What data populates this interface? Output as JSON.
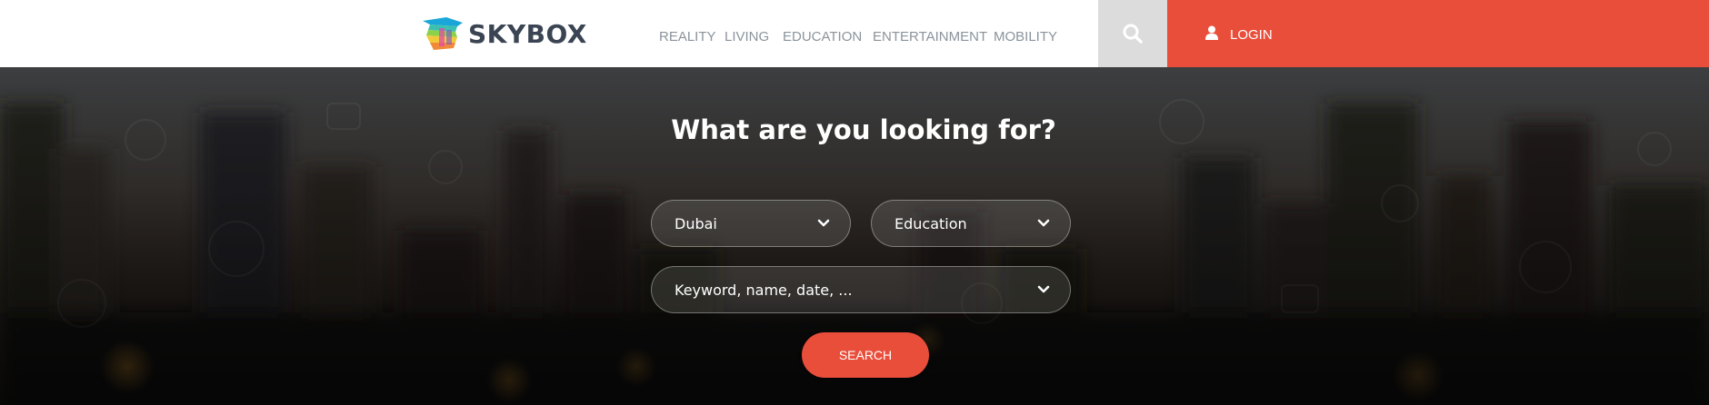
{
  "brand": {
    "name": "SKYBOX"
  },
  "nav": {
    "items": [
      {
        "label": "REALITY"
      },
      {
        "label": "LIVING"
      },
      {
        "label": "EDUCATION"
      },
      {
        "label": "ENTERTAINMENT"
      },
      {
        "label": "MOBILITY"
      }
    ]
  },
  "header": {
    "search_icon": "search-icon",
    "login_label": "LOGIN",
    "login_icon": "user-icon"
  },
  "hero": {
    "title": "What are you looking for?",
    "location_select": {
      "value": "Dubai"
    },
    "category_select": {
      "value": "Education"
    },
    "keyword_field": {
      "placeholder": "Keyword, name, date, ..."
    },
    "search_label": "SEARCH"
  },
  "colors": {
    "accent": "#e94e3a",
    "search_bg": "#dcdcdc",
    "nav_text": "#8a949c",
    "logo_text": "#3a4452"
  }
}
